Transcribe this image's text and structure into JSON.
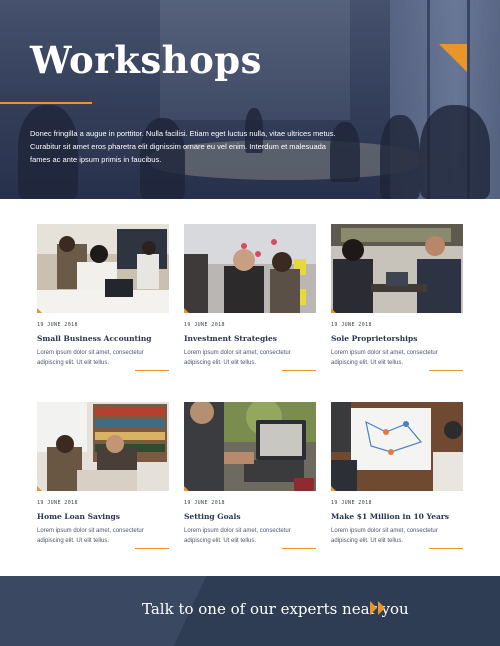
{
  "hero": {
    "title": "Workshops",
    "intro": "Donec fringilla a augue in porttitor. Nulla facilisi. Etiam eget luctus nulla, vitae ultrices metus. Curabitur sit amet eros pharetra elit dignissim ornare eu vel enim. Interdum et malesuada fames ac ante ipsum primis in faucibus."
  },
  "workshops": [
    {
      "date": "19 JUNE 2018",
      "title": "Small Business Accounting",
      "description": "Lorem ipsum dolor sit amet, consectetur adipiscing elit. Ut elit tellus."
    },
    {
      "date": "19 JUNE 2018",
      "title": "Investment Strategies",
      "description": "Lorem ipsum dolor sit amet, consectetur adipiscing elit. Ut elit tellus."
    },
    {
      "date": "19 JUNE 2018",
      "title": "Sole Proprietorships",
      "description": "Lorem ipsum dolor sit amet, consectetur adipiscing elit. Ut elit tellus."
    },
    {
      "date": "19 JUNE 2018",
      "title": "Home Loan Savings",
      "description": "Lorem ipsum dolor sit amet, consectetur adipiscing elit. Ut elit tellus."
    },
    {
      "date": "19 JUNE 2018",
      "title": "Setting Goals",
      "description": "Lorem ipsum dolor sit amet, consectetur adipiscing elit. Ut elit tellus."
    },
    {
      "date": "19 JUNE 2018",
      "title": "Make $1 Million in 10 Years",
      "description": "Lorem ipsum dolor sit amet, consectetur adipiscing elit. Ut elit tellus."
    }
  ],
  "footer": {
    "cta": "Talk to one of our experts near you",
    "cta_icon": "double-chevron-right-icon"
  },
  "colors": {
    "accent": "#e8962a",
    "navy": "#2e3c54",
    "heading": "#2a3550"
  }
}
